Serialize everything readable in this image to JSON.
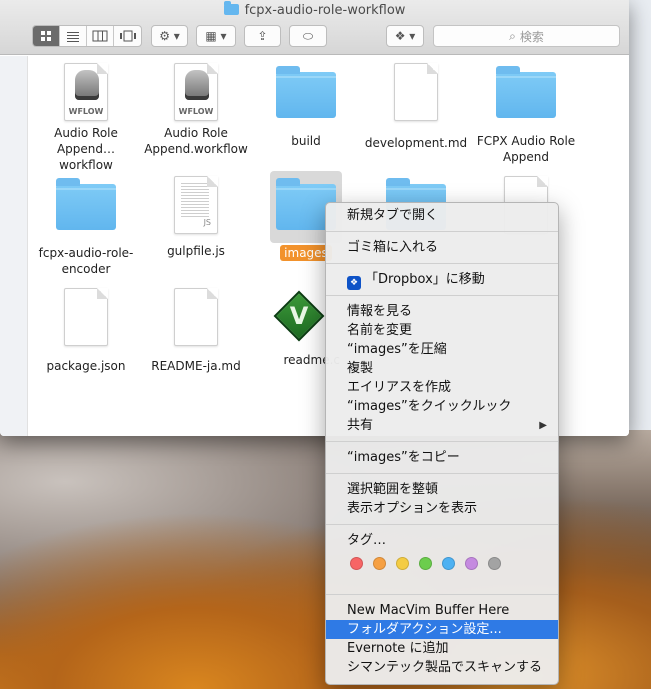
{
  "window": {
    "title": "fcpx-audio-role-workflow"
  },
  "toolbar": {
    "view_icons": [
      "icon-view",
      "list-view",
      "column-view",
      "coverflow-view"
    ],
    "action_glyph": "⚙ ▾",
    "arrange_glyph": "▦ ▾",
    "share_glyph": "⇪",
    "tag_glyph": "⬭",
    "dropbox_glyph": "❖ ▾",
    "search_placeholder": "検索"
  },
  "files": [
    {
      "name": "Audio Role Append…workflow",
      "line1": "Audio Role",
      "line2": "Append…workflow",
      "kind": "workflow"
    },
    {
      "name": "Audio Role Append.workflow",
      "line1": "Audio Role",
      "line2": "Append.workflow",
      "kind": "workflow"
    },
    {
      "name": "build",
      "line1": "build",
      "line2": "",
      "kind": "folder"
    },
    {
      "name": "development.md",
      "line1": "development.md",
      "line2": "",
      "kind": "doc"
    },
    {
      "name": "FCPX Audio Role Append",
      "line1": "FCPX Audio Role",
      "line2": "Append",
      "kind": "folder"
    },
    {
      "name": "fcpx-audio-role-encoder",
      "line1": "fcpx-audio-role-",
      "line2": "encoder",
      "kind": "folder"
    },
    {
      "name": "gulpfile.js",
      "line1": "gulpfile.js",
      "line2": "",
      "kind": "js"
    },
    {
      "name": "images",
      "line1": "images",
      "line2": "",
      "kind": "folder",
      "selected": true
    },
    {
      "name": "package.json",
      "line1": "package.json",
      "line2": "",
      "kind": "doc"
    },
    {
      "name": "README-ja.md",
      "line1": "README-ja.md",
      "line2": "",
      "kind": "doc"
    },
    {
      "name": "readme.c",
      "line1": "readme.c",
      "line2": "",
      "kind": "vim"
    }
  ],
  "workflow_tag": "WFLOW",
  "js_tag": "JS",
  "context_menu": {
    "open_new_tab": "新規タブで開く",
    "move_to_trash": "ゴミ箱に入れる",
    "dropbox_move": "「Dropbox」に移動",
    "get_info": "情報を見る",
    "rename": "名前を変更",
    "compress": "“images”を圧縮",
    "duplicate": "複製",
    "make_alias": "エイリアスを作成",
    "quick_look": "“images”をクイックルック",
    "share": "共有",
    "share_arrow": "▶",
    "copy": "“images”をコピー",
    "clean_up_selection": "選択範囲を整頓",
    "show_view_options": "表示オプションを表示",
    "tags": "タグ…",
    "tag_colors": [
      "#f76565",
      "#f6a042",
      "#f4cc43",
      "#6ccd4d",
      "#4db1f2",
      "#c58ae0",
      "#a3a3a3"
    ],
    "new_macvim_buffer": "New MacVim Buffer Here",
    "folder_actions_setup": "フォルダアクション設定...",
    "evernote_add": "Evernote に追加",
    "symantec_scan": "シマンテック製品でスキャンする"
  }
}
